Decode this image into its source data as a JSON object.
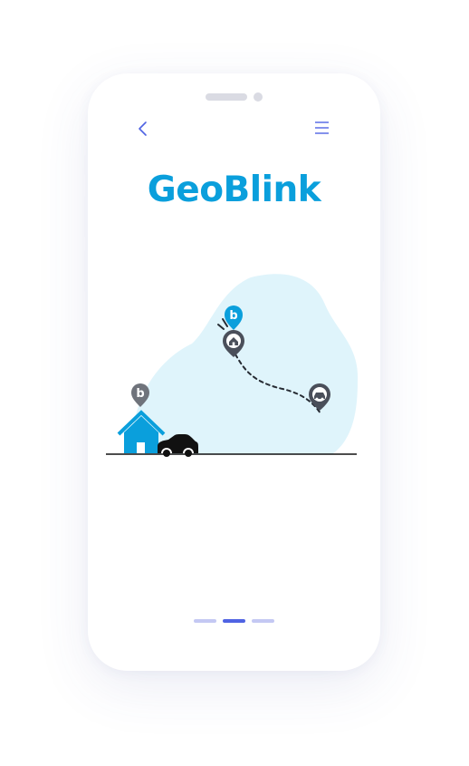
{
  "app": {
    "title": "GeoBlink"
  },
  "nav": {
    "back_icon": "chevron-left-icon",
    "menu_icon": "hamburger-menu-icon"
  },
  "illustration": {
    "pin_letter": "b",
    "icons": [
      "house-icon",
      "car-icon",
      "location-pin-icon",
      "home-pin-icon",
      "car-pin-icon"
    ]
  },
  "pager": {
    "total": 3,
    "active_index": 1
  },
  "colors": {
    "brand": "#0a9fdc",
    "accent": "#4f63e3",
    "accent_light": "#c4c8f3",
    "blob": "#dff4fb",
    "pin_dark": "#4a4f5a",
    "ground": "#111111"
  }
}
